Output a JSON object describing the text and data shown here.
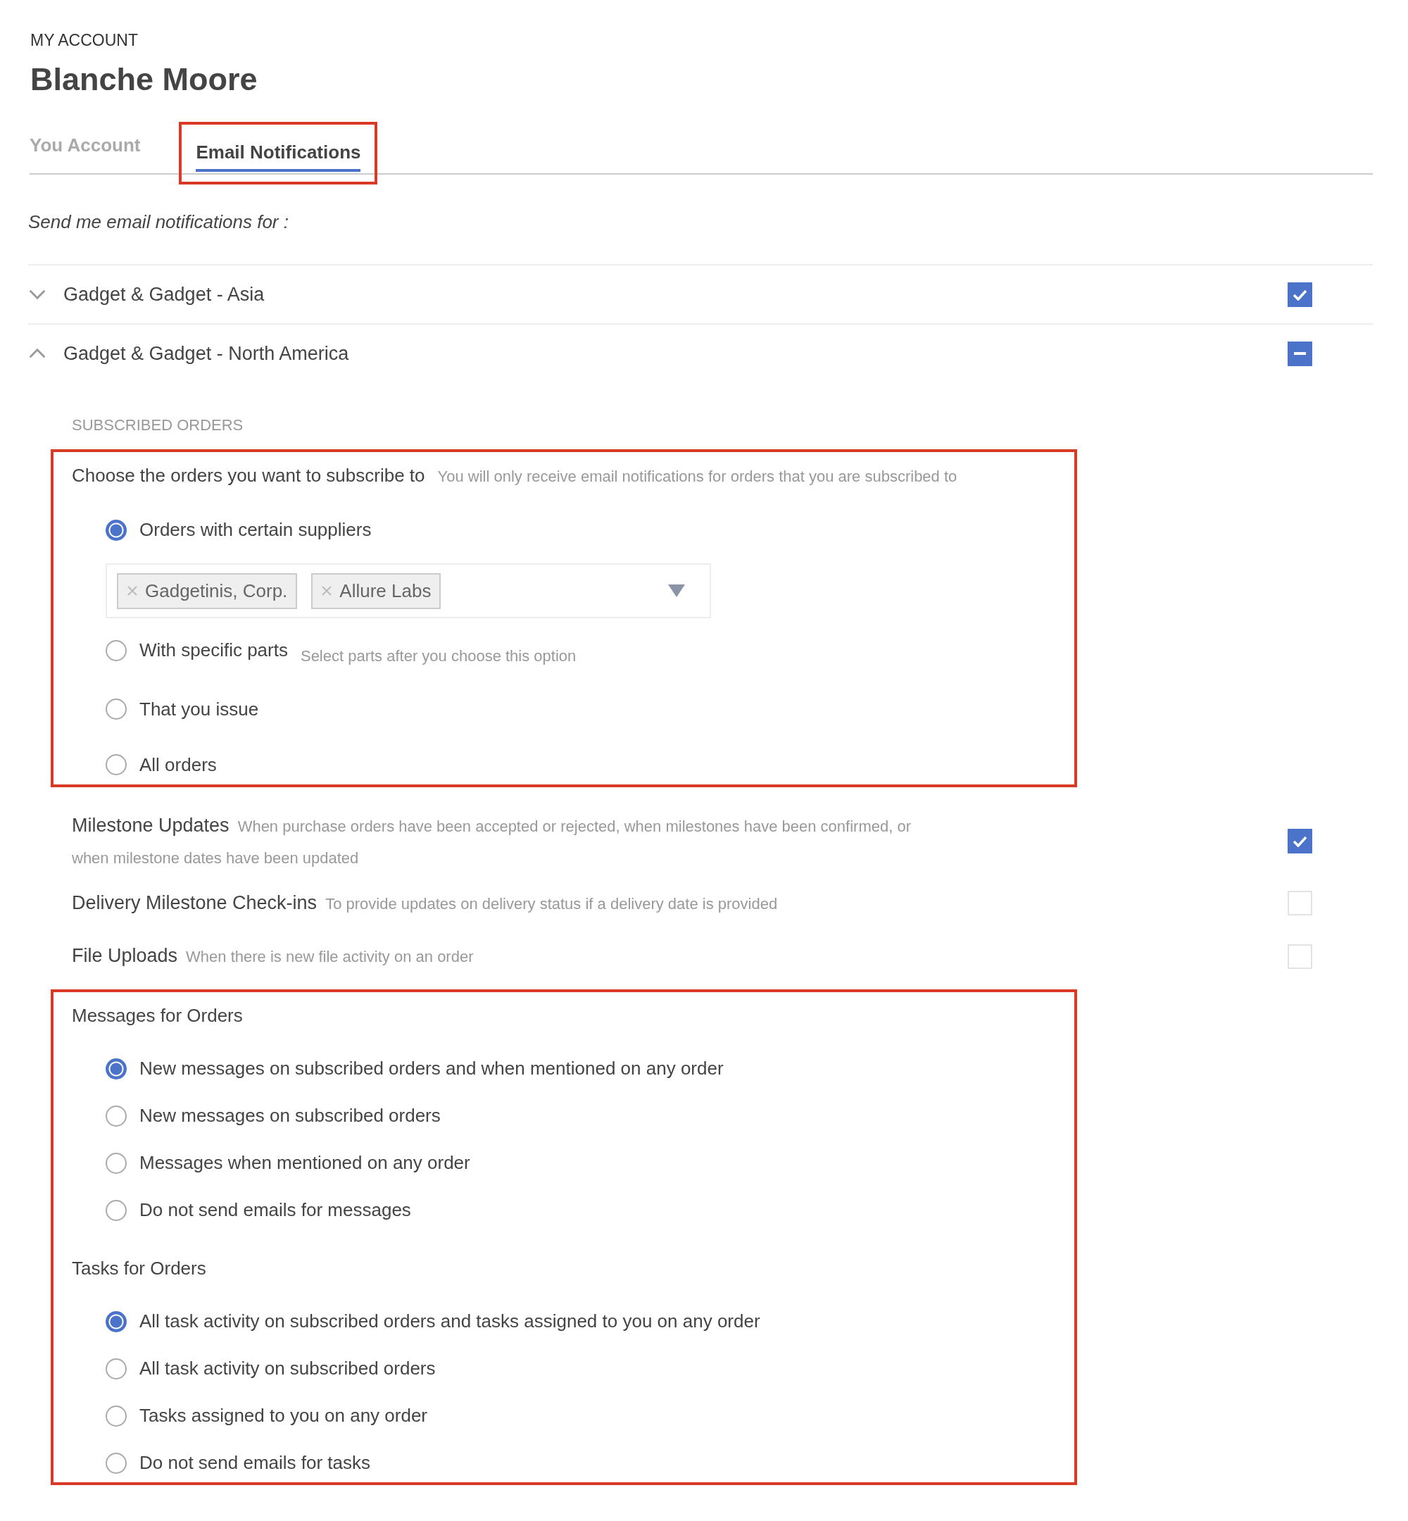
{
  "header": {
    "eyebrow": "MY ACCOUNT",
    "name": "Blanche Moore"
  },
  "tabs": [
    {
      "label": "You Account",
      "selected": false,
      "highlighted": false
    },
    {
      "label": "Email Notifications",
      "selected": true,
      "highlighted": true
    }
  ],
  "intro": "Send me email notifications for :",
  "groups": [
    {
      "name": "Gadget & Gadget - Asia",
      "expanded": false,
      "checked": true,
      "partial": false
    },
    {
      "name": "Gadget & Gadget - North America",
      "expanded": true,
      "checked": true,
      "partial": true
    }
  ],
  "subscribed_orders": {
    "heading": "SUBSCRIBED ORDERS",
    "highlighted": true,
    "title": "Choose the orders you want to subscribe to",
    "hint": "You will only receive email notifications for orders that you are subscribed to",
    "options": [
      {
        "label": "Orders with certain suppliers",
        "selected": true,
        "tags": [
          "Gadgetinis, Corp.",
          "Allure Labs"
        ]
      },
      {
        "label": "With specific parts",
        "selected": false,
        "hint": "Select parts after you choose this option"
      },
      {
        "label": "That you issue",
        "selected": false
      },
      {
        "label": "All orders",
        "selected": false
      }
    ]
  },
  "notifications": [
    {
      "title": "Milestone Updates",
      "hint": "When purchase orders have been accepted or rejected, when milestones have been confirmed, or when milestone dates have been updated",
      "checked": true
    },
    {
      "title": "Delivery Milestone Check-ins",
      "hint": "To provide updates on delivery status if a delivery date is provided",
      "checked": false
    },
    {
      "title": "File Uploads",
      "hint": "When there is new file activity on an order",
      "checked": false
    }
  ],
  "order_activity": {
    "highlighted": true,
    "groups": [
      {
        "title": "Messages for Orders",
        "options": [
          {
            "label": "New messages on subscribed orders and when mentioned on any order",
            "selected": true
          },
          {
            "label": "New messages on subscribed orders",
            "selected": false
          },
          {
            "label": "Messages when mentioned on any order",
            "selected": false
          },
          {
            "label": "Do not send emails for messages",
            "selected": false
          }
        ]
      },
      {
        "title": "Tasks for Orders",
        "options": [
          {
            "label": "All task activity on subscribed orders and tasks assigned to you on any order",
            "selected": true
          },
          {
            "label": "All task activity on subscribed orders",
            "selected": false
          },
          {
            "label": "Tasks assigned to you on any order",
            "selected": false
          },
          {
            "label": "Do not send emails for tasks",
            "selected": false
          }
        ]
      }
    ]
  }
}
